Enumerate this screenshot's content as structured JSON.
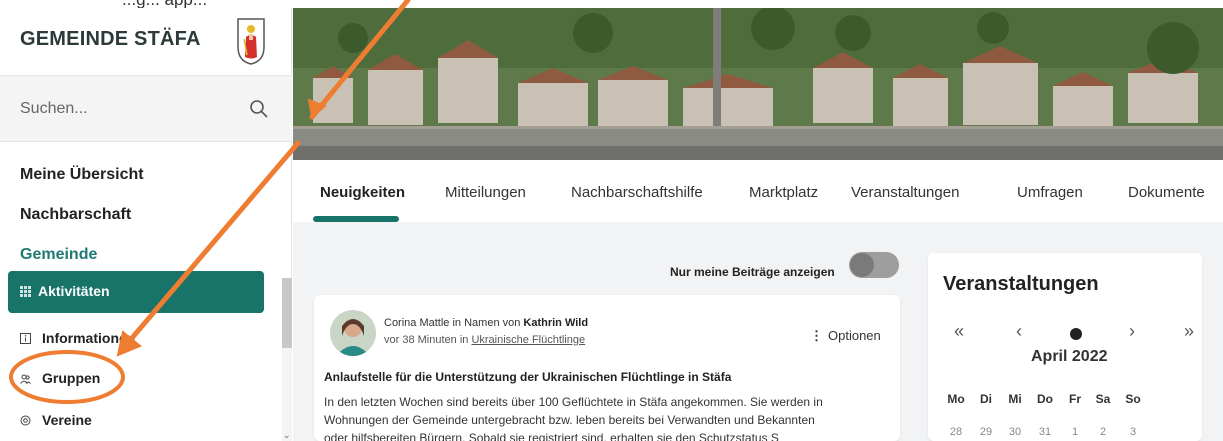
{
  "top_fragment": "...g... app...",
  "sidebar": {
    "brand_title": "GEMEINDE STÄFA",
    "search_placeholder": "Suchen...",
    "nav_meine_uebersicht": "Meine Übersicht",
    "nav_nachbarschaft": "Nachbarschaft",
    "nav_gemeinde": "Gemeinde",
    "items": [
      {
        "label": "Aktivitäten",
        "icon": "grid-icon",
        "active": true
      },
      {
        "label": "Informationen",
        "icon": "info-icon",
        "active": false
      },
      {
        "label": "Gruppen",
        "icon": "people-icon",
        "active": false
      },
      {
        "label": "Vereine",
        "icon": "gear-icon",
        "active": false
      }
    ]
  },
  "tabs": [
    "Neuigkeiten",
    "Mitteilungen",
    "Nachbarschaftshilfe",
    "Marktplatz",
    "Veranstaltungen",
    "Umfragen",
    "Dokumente"
  ],
  "feed": {
    "toggle_label": "Nur meine Beiträge anzeigen",
    "post": {
      "author": "Corina Mattle",
      "author_connector": " in Namen von ",
      "on_behalf_of": "Kathrin Wild",
      "meta_prefix": "vor 38 Minuten in ",
      "group_link": "Ukrainische Flüchtlinge",
      "options_label": "Optionen",
      "title": "Anlaufstelle für die Unterstützung der Ukrainischen Flüchtlinge in Stäfa",
      "body_line1": "In den letzten Wochen sind bereits über 100 Geflüchtete in Stäfa angekommen. Sie werden in",
      "body_line2": "Wohnungen der Gemeinde untergebracht bzw. leben bereits bei Verwandten und Bekannten",
      "body_line3": "oder hilfsbereiten Bürgern. Sobald sie registriert sind, erhalten sie den Schutzstatus S"
    }
  },
  "events": {
    "title": "Veranstaltungen",
    "nav": {
      "first": "«",
      "prev": "‹",
      "next": "›",
      "last": "»"
    },
    "month": "April 2022",
    "weekdays": [
      "Mo",
      "Di",
      "Mi",
      "Do",
      "Fr",
      "Sa",
      "So"
    ],
    "first_week": [
      "28",
      "29",
      "30",
      "31",
      "1",
      "2",
      "3"
    ]
  },
  "colors": {
    "accent": "#187469",
    "annotation": "#ef7d31"
  }
}
